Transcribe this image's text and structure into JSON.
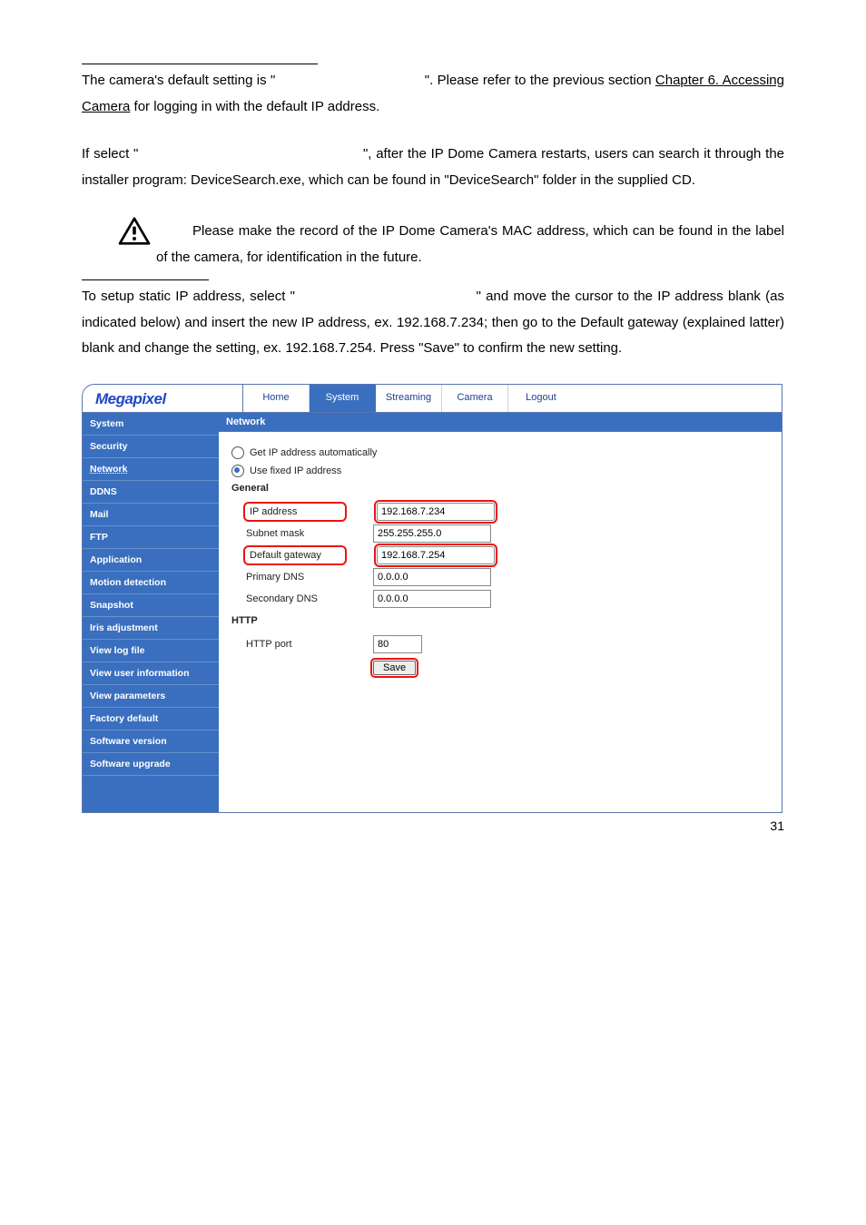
{
  "para1_parts": {
    "a": "The camera's default setting is \"",
    "b": "\". Please refer to the previous section ",
    "link": "Chapter 6. Accessing Camera",
    "c": " for logging in with the default IP address."
  },
  "para2_parts": {
    "a": "If select \"",
    "b": "\", after the IP Dome Camera restarts, users can search it through the installer program: DeviceSearch.exe, which can be found in \"DeviceSearch\" folder in the supplied CD."
  },
  "note": "Please make the record of the IP Dome Camera's MAC address, which can be found in the label of the camera, for identification in the future.",
  "para3_parts": {
    "a": "To setup static IP address, select \"",
    "b": "\" and move the cursor to the IP address blank (as indicated below) and insert the new IP address, ex. 192.168.7.234; then go to the Default gateway (explained latter) blank and change the setting, ex. 192.168.7.254. Press \"Save\" to confirm the new setting."
  },
  "ui": {
    "brand": "Megapixel",
    "tabs": [
      "Home",
      "System",
      "Streaming",
      "Camera",
      "Logout"
    ],
    "active_tab": 1,
    "sidebar": [
      "System",
      "Security",
      "Network",
      "DDNS",
      "Mail",
      "FTP",
      "Application",
      "Motion detection",
      "Snapshot",
      "Iris adjustment",
      "View log file",
      "View user information",
      "View parameters",
      "Factory default",
      "Software version",
      "Software upgrade"
    ],
    "sidebar_current": 2,
    "content_title": "Network",
    "radio_auto": "Get IP address automatically",
    "radio_fixed": "Use fixed IP address",
    "section_general": "General",
    "fields": {
      "ip_label": "IP address",
      "ip_value": "192.168.7.234",
      "mask_label": "Subnet mask",
      "mask_value": "255.255.255.0",
      "gw_label": "Default gateway",
      "gw_value": "192.168.7.254",
      "dns1_label": "Primary DNS",
      "dns1_value": "0.0.0.0",
      "dns2_label": "Secondary DNS",
      "dns2_value": "0.0.0.0"
    },
    "section_http": "HTTP",
    "http_port_label": "HTTP port",
    "http_port_value": "80",
    "save_label": "Save"
  },
  "page_number": "31"
}
